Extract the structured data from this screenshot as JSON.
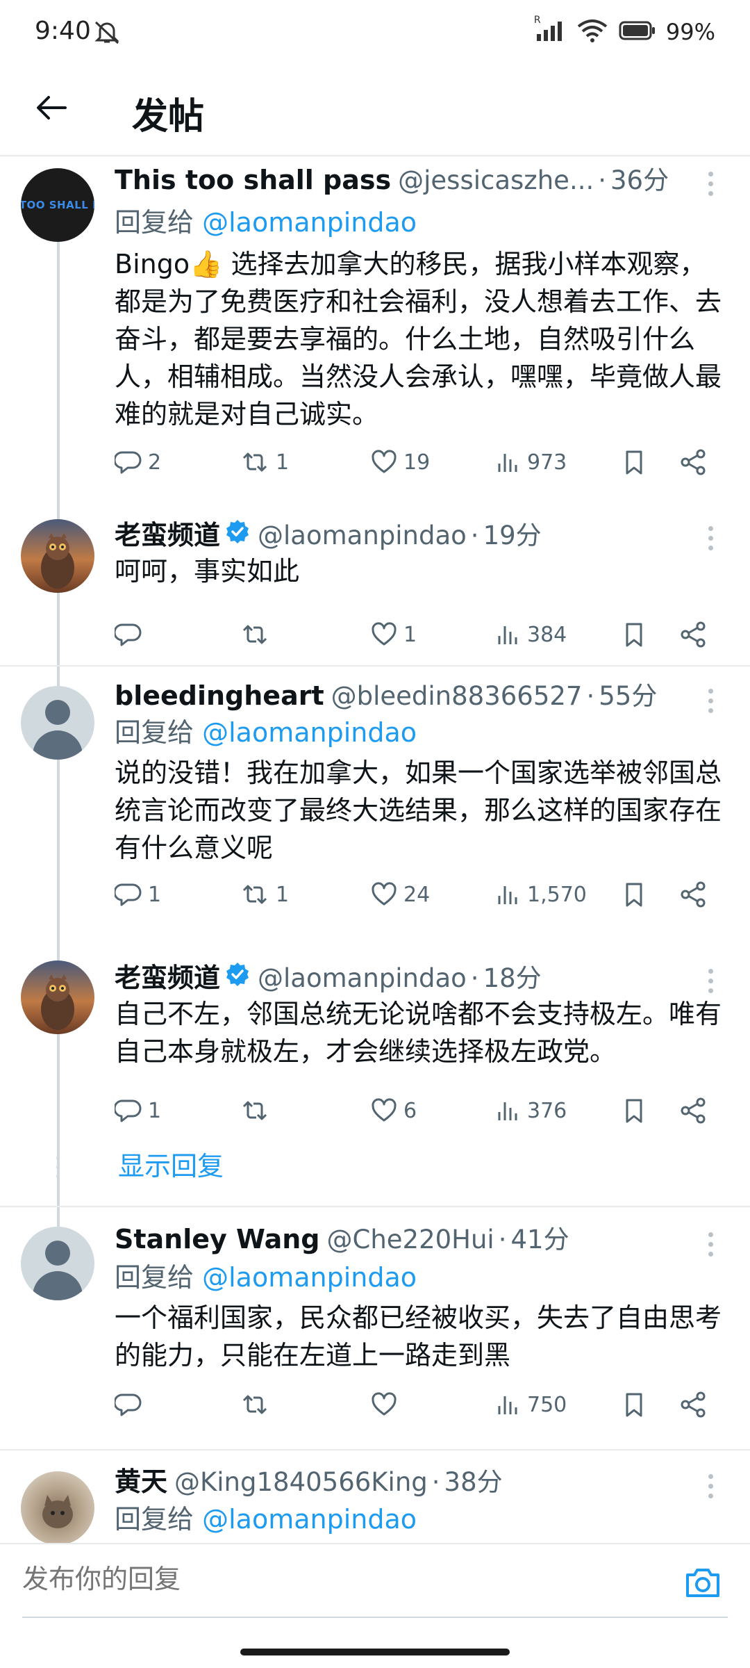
{
  "status_bar": {
    "time": "9:40",
    "battery": "99%",
    "network_tag": "R"
  },
  "header": {
    "title": "发帖"
  },
  "show_replies_label": "显示回复",
  "compose": {
    "placeholder": "发布你的回复"
  },
  "colors": {
    "link": "#1d9bf0",
    "secondary_text": "#536471",
    "verified": "#1d9bf0"
  },
  "posts": [
    {
      "name": "This too shall pass",
      "handle": "@jessicaszhe...",
      "time": "36分",
      "reply_prefix": "回复给",
      "reply_to": "@laomanpindao",
      "avatar_text": "S TOO SHALL PA",
      "text": "Bingo👍 选择去加拿大的移民，据我小样本观察，都是为了免费医疗和社会福利，没人想着去工作、去奋斗，都是要去享福的。什么土地，自然吸引什么人，相辅相成。当然没人会承认，嘿嘿，毕竟做人最难的就是对自己诚实。",
      "replies": "2",
      "reposts": "1",
      "likes": "19",
      "views": "973"
    },
    {
      "name": "老蛮频道",
      "handle": "@laomanpindao",
      "time": "19分",
      "verified": true,
      "text": "呵呵，事实如此",
      "replies": "",
      "reposts": "",
      "likes": "1",
      "views": "384"
    },
    {
      "name": "bleedingheart",
      "handle": "@bleedin88366527",
      "time": "55分",
      "reply_prefix": "回复给",
      "reply_to": "@laomanpindao",
      "text": "说的没错！我在加拿大，如果一个国家选举被邻国总统言论而改变了最终大选结果，那么这样的国家存在有什么意义呢",
      "replies": "1",
      "reposts": "1",
      "likes": "24",
      "views": "1,570"
    },
    {
      "name": "老蛮频道",
      "handle": "@laomanpindao",
      "time": "18分",
      "verified": true,
      "text": "自己不左，邻国总统无论说啥都不会支持极左。唯有自己本身就极左，才会继续选择极左政党。",
      "replies": "1",
      "reposts": "",
      "likes": "6",
      "views": "376"
    },
    {
      "name": "Stanley Wang",
      "handle": "@Che220Hui",
      "time": "41分",
      "reply_prefix": "回复给",
      "reply_to": "@laomanpindao",
      "text": "一个福利国家，民众都已经被收买，失去了自由思考的能力，只能在左道上一路走到黑",
      "replies": "",
      "reposts": "",
      "likes": "",
      "views": "750"
    },
    {
      "name": "黄天",
      "handle": "@King1840566King",
      "time": "38分",
      "reply_prefix": "回复给",
      "reply_to": "@laomanpindao"
    }
  ],
  "icons": [
    "back-arrow-icon",
    "reply-icon",
    "repost-icon",
    "like-icon",
    "views-icon",
    "bookmark-icon",
    "share-icon",
    "more-icon",
    "verified-icon",
    "camera-icon",
    "wifi-icon",
    "signal-icon",
    "battery-icon",
    "mute-icon"
  ]
}
